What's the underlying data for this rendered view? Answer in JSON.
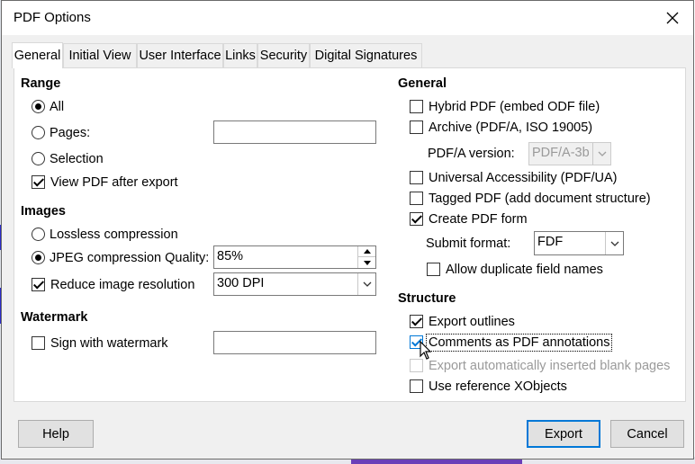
{
  "window": {
    "title": "PDF Options"
  },
  "tabs": [
    {
      "label": "General",
      "active": true
    },
    {
      "label": "Initial View",
      "active": false
    },
    {
      "label": "User Interface",
      "active": false
    },
    {
      "label": "Links",
      "active": false
    },
    {
      "label": "Security",
      "active": false
    },
    {
      "label": "Digital Signatures",
      "active": false
    }
  ],
  "range": {
    "title": "Range",
    "all_label": "All",
    "pages_label": "Pages:",
    "pages_value": "",
    "selection_label": "Selection",
    "selected": "All",
    "view_pdf_label": "View PDF after export",
    "view_pdf_checked": true
  },
  "images": {
    "title": "Images",
    "lossless_label": "Lossless compression",
    "jpeg_label": "JPEG compression Quality:",
    "jpeg_quality": "85%",
    "selected": "JPEG compression",
    "reduce_label": "Reduce image resolution",
    "reduce_checked": true,
    "resolution": "300 DPI"
  },
  "watermark": {
    "title": "Watermark",
    "sign_label": "Sign with watermark",
    "sign_checked": false,
    "watermark_text": ""
  },
  "general": {
    "title": "General",
    "hybrid_label": "Hybrid PDF (embed ODF file)",
    "hybrid_checked": false,
    "archive_label": "Archive (PDF/A, ISO 19005)",
    "archive_checked": false,
    "pdfa_version_label": "PDF/A version:",
    "pdfa_version": "PDF/A-3b",
    "ua_label": "Universal Accessibility (PDF/UA)",
    "ua_checked": false,
    "tagged_label": "Tagged PDF (add document structure)",
    "tagged_checked": false,
    "form_label": "Create PDF form",
    "form_checked": true,
    "submit_format_label": "Submit format:",
    "submit_format": "FDF",
    "dup_names_label": "Allow duplicate field names",
    "dup_names_checked": false
  },
  "structure": {
    "title": "Structure",
    "outlines_label": "Export outlines",
    "outlines_checked": true,
    "comments_label": "Comments as PDF annotations",
    "comments_checked": true,
    "blank_pages_label": "Export automatically inserted blank pages",
    "blank_pages_checked": false,
    "xobjects_label": "Use reference XObjects",
    "xobjects_checked": false
  },
  "buttons": {
    "help": "Help",
    "export": "Export",
    "cancel": "Cancel"
  },
  "icons": {
    "close": "close-icon",
    "dropdown": "chevron-down-icon",
    "spin_up": "spin-up-icon",
    "spin_down": "spin-down-icon",
    "cursor": "mouse-pointer-icon"
  }
}
